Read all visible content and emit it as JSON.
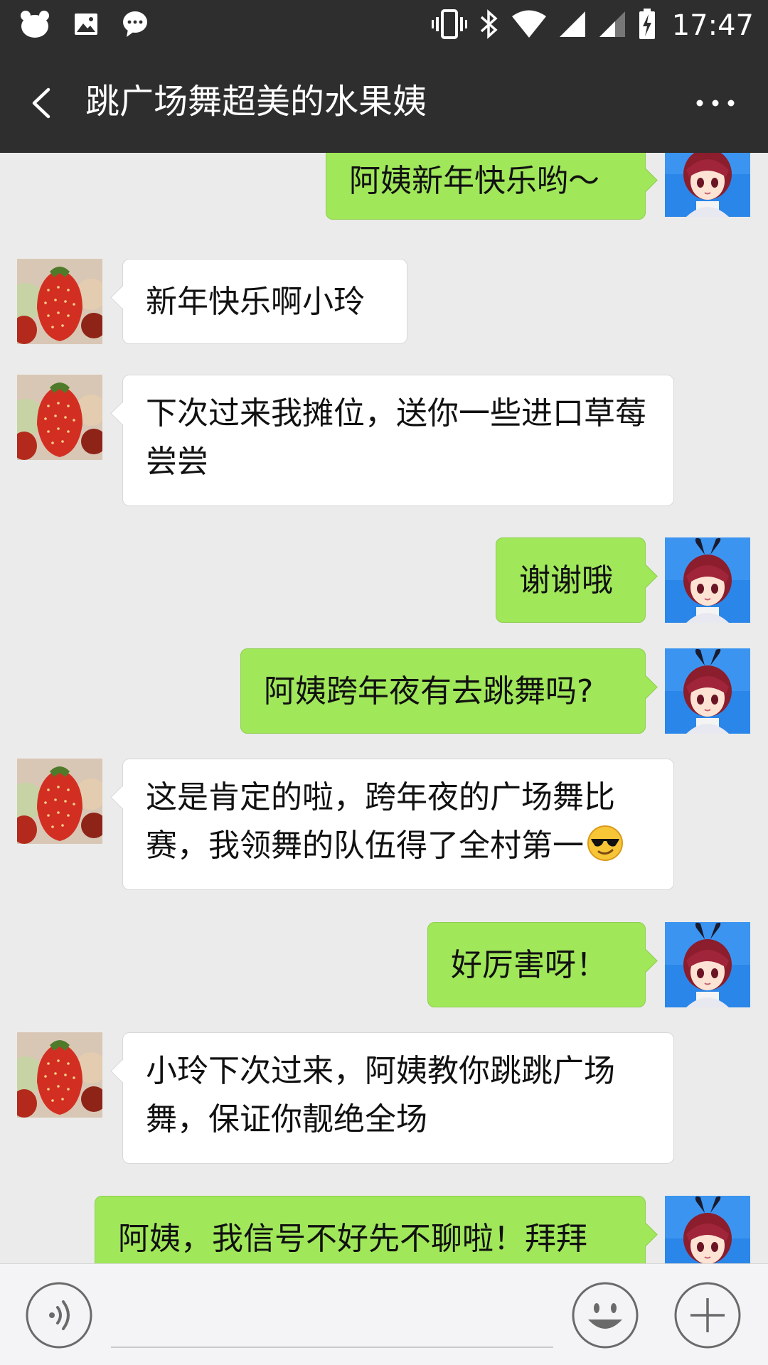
{
  "status_bar": {
    "time": "17:47",
    "left_icons": [
      "bear-app-icon",
      "gallery-icon",
      "message-icon"
    ],
    "right_icons": [
      "vibrate-icon",
      "bluetooth-icon",
      "wifi-icon",
      "signal-icon",
      "signal-icon",
      "battery-charging-icon"
    ]
  },
  "header": {
    "title": "跳广场舞超美的水果姨",
    "back_icon": "back-chevron-icon",
    "more_icon": "more-dots-icon"
  },
  "messages": [
    {
      "side": "right",
      "sender": "me",
      "avatar": "anime-girl-avatar",
      "text": "阿姨新年快乐哟～"
    },
    {
      "side": "left",
      "sender": "auntie",
      "avatar": "strawberry-avatar",
      "text": "新年快乐啊小玲"
    },
    {
      "side": "left",
      "sender": "auntie",
      "avatar": "strawberry-avatar",
      "text": "下次过来我摊位，送你一些进口草莓尝尝"
    },
    {
      "side": "right",
      "sender": "me",
      "avatar": "anime-girl-avatar",
      "text": "谢谢哦"
    },
    {
      "side": "right",
      "sender": "me",
      "avatar": "anime-girl-avatar",
      "text": "阿姨跨年夜有去跳舞吗?"
    },
    {
      "side": "left",
      "sender": "auntie",
      "avatar": "strawberry-avatar",
      "text": "这是肯定的啦，跨年夜的广场舞比赛，我领舞的队伍得了全村第一",
      "emoji": "sunglasses-emoji"
    },
    {
      "side": "right",
      "sender": "me",
      "avatar": "anime-girl-avatar",
      "text": "好厉害呀！"
    },
    {
      "side": "left",
      "sender": "auntie",
      "avatar": "strawberry-avatar",
      "text": "小玲下次过来，阿姨教你跳跳广场舞，保证你靓绝全场"
    },
    {
      "side": "right",
      "sender": "me",
      "avatar": "anime-girl-avatar",
      "text": "阿姨，我信号不好先不聊啦！拜拜"
    }
  ],
  "input_bar": {
    "voice_icon": "voice-icon",
    "emoji_icon": "smiley-icon",
    "plus_icon": "plus-icon",
    "input_value": ""
  },
  "colors": {
    "header_bg": "#2e2e2e",
    "chat_bg": "#ebebeb",
    "sent_bubble": "#a0e75a",
    "received_bubble": "#ffffff"
  }
}
